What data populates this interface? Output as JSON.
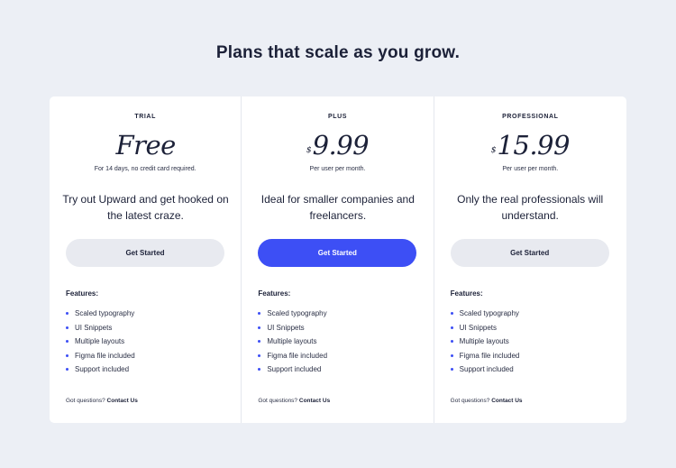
{
  "page": {
    "title": "Plans that scale as you grow."
  },
  "colors": {
    "background": "#eceff5",
    "card": "#ffffff",
    "accent": "#3d4ff5",
    "button_neutral": "#e8eaf0",
    "text": "#1c2138"
  },
  "plans": [
    {
      "tier": "TRIAL",
      "currency": "",
      "price": "Free",
      "price_note": "For 14 days, no credit card required.",
      "description": "Try out Upward and get hooked on the latest craze.",
      "cta_label": "Get Started",
      "cta_highlighted": false,
      "features_title": "Features:",
      "features": [
        "Scaled typography",
        "UI Snippets",
        "Multiple layouts",
        "Figma file included",
        "Support included"
      ],
      "questions_text": "Got questions?",
      "contact_label": "Contact Us"
    },
    {
      "tier": "PLUS",
      "currency": "$",
      "price": "9.99",
      "price_note": "Per user per month.",
      "description": "Ideal for smaller companies and freelancers.",
      "cta_label": "Get Started",
      "cta_highlighted": true,
      "features_title": "Features:",
      "features": [
        "Scaled typography",
        "UI Snippets",
        "Multiple layouts",
        "Figma file included",
        "Support included"
      ],
      "questions_text": "Got questions?",
      "contact_label": "Contact Us"
    },
    {
      "tier": "PROFESSIONAL",
      "currency": "$",
      "price": "15.99",
      "price_note": "Per user per month.",
      "description": "Only the real professionals will understand.",
      "cta_label": "Get Started",
      "cta_highlighted": false,
      "features_title": "Features:",
      "features": [
        "Scaled typography",
        "UI Snippets",
        "Multiple layouts",
        "Figma file included",
        "Support included"
      ],
      "questions_text": "Got questions?",
      "contact_label": "Contact Us"
    }
  ]
}
